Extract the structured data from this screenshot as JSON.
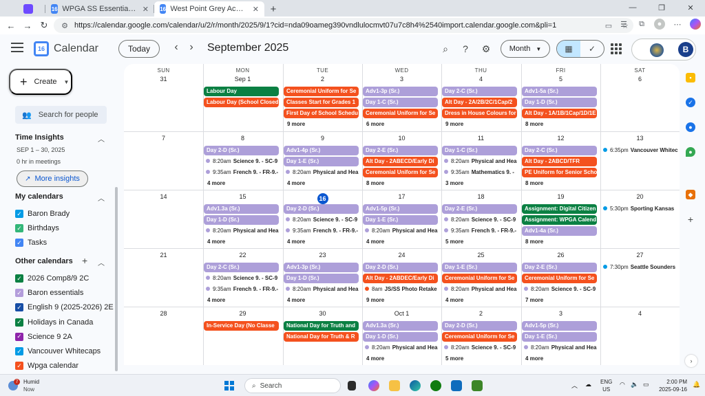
{
  "browser": {
    "tabs": [
      {
        "title": "WPGA SS Essential Calendar",
        "icon": "calendar-tab-icon",
        "color": "#4285f4"
      },
      {
        "title": "West Point Grey Academy - Calen",
        "icon": "calendar-tab-icon",
        "color": "#4285f4"
      }
    ],
    "url": "https://calendar.google.com/calendar/u/2/r/month/2025/9/1?cid=nda09oameg390vndlulocmvt07u7c8h4%2540import.calendar.google.com&pli=1"
  },
  "header": {
    "app_title": "Calendar",
    "logo_text": "16",
    "today_label": "Today",
    "month_title": "September 2025",
    "view_label": "Month",
    "avatar_letter": "B"
  },
  "sidebar": {
    "create_label": "Create",
    "search_people_placeholder": "Search for people",
    "time_insights_title": "Time Insights",
    "insights_range": "SEP 1 – 30, 2025",
    "insights_meetings": "0 hr in meetings",
    "more_insights_label": "More insights",
    "my_calendars_title": "My calendars",
    "my_calendars": [
      {
        "label": "Baron Brady",
        "color": "#039be5"
      },
      {
        "label": "Birthdays",
        "color": "#33b679"
      },
      {
        "label": "Tasks",
        "color": "#4285f4"
      }
    ],
    "other_calendars_title": "Other calendars",
    "other_calendars": [
      {
        "label": "2026 Comp8/9 2C",
        "color": "#0b8043"
      },
      {
        "label": "Baron essentials",
        "color": "#b39ddb"
      },
      {
        "label": "English 9 (2025-2026) 2E",
        "color": "#174ea6"
      },
      {
        "label": "Holidays in Canada",
        "color": "#0b8043"
      },
      {
        "label": "Science 9 2A",
        "color": "#8e24aa"
      },
      {
        "label": "Vancouver Whitecaps",
        "color": "#039be5"
      },
      {
        "label": "Wpga calendar",
        "color": "#f4511e"
      }
    ]
  },
  "calendar": {
    "weekdays": [
      "SUN",
      "MON",
      "TUE",
      "WED",
      "THU",
      "FRI",
      "SAT"
    ],
    "weeks": [
      [
        {
          "label": "31",
          "items": []
        },
        {
          "label": "Sep 1",
          "items": [
            {
              "kind": "chip",
              "color": "green",
              "text": "Labour Day"
            },
            {
              "kind": "chip",
              "color": "red",
              "text": "Labour Day (School Closed)"
            }
          ]
        },
        {
          "label": "2",
          "items": [
            {
              "kind": "chip",
              "color": "red",
              "text": "Ceremonial Uniform for Se"
            },
            {
              "kind": "chip",
              "color": "red",
              "text": "Classes Start for Grades 1"
            },
            {
              "kind": "chip",
              "color": "red",
              "text": "First Day of School Schedu"
            }
          ],
          "more": "9 more"
        },
        {
          "label": "3",
          "items": [
            {
              "kind": "chip",
              "color": "purple",
              "text": "Adv1-3p (Sr.)"
            },
            {
              "kind": "chip",
              "color": "purple",
              "text": "Day 1-C (Sr.)"
            },
            {
              "kind": "chip",
              "color": "red",
              "text": "Ceremonial Uniform for Se"
            }
          ],
          "more": "6 more"
        },
        {
          "label": "4",
          "items": [
            {
              "kind": "chip",
              "color": "purple",
              "text": "Day 2-C (Sr.)"
            },
            {
              "kind": "chip",
              "color": "red",
              "text": "Alt Day - 2A/2B/2C/1Cap/2"
            },
            {
              "kind": "chip",
              "color": "red",
              "text": "Dress in House Colours for"
            }
          ],
          "more": "9 more"
        },
        {
          "label": "5",
          "items": [
            {
              "kind": "chip",
              "color": "purple",
              "text": "Adv1-5a (Sr.)"
            },
            {
              "kind": "chip",
              "color": "purple",
              "text": "Day 1-D (Sr.)"
            },
            {
              "kind": "chip",
              "color": "red",
              "text": "Alt Day - 1A/1B/1Cap/1D/1E"
            }
          ],
          "more": "8 more"
        },
        {
          "label": "6",
          "items": []
        }
      ],
      [
        {
          "label": "7",
          "items": []
        },
        {
          "label": "8",
          "items": [
            {
              "kind": "chip",
              "color": "purple",
              "text": "Day 2-D (Sr.)"
            },
            {
              "kind": "event",
              "dot": "#ad9fd9",
              "time": "8:20am",
              "title": "Science 9. - SC-9"
            },
            {
              "kind": "event",
              "dot": "#ad9fd9",
              "time": "9:35am",
              "title": "French 9. - FR-9.-"
            }
          ],
          "more": "4 more"
        },
        {
          "label": "9",
          "items": [
            {
              "kind": "chip",
              "color": "purple",
              "text": "Adv1-4p (Sr.)"
            },
            {
              "kind": "chip",
              "color": "purple",
              "text": "Day 1-E (Sr.)"
            },
            {
              "kind": "event",
              "dot": "#ad9fd9",
              "time": "8:20am",
              "title": "Physical and Hea"
            }
          ],
          "more": "4 more"
        },
        {
          "label": "10",
          "items": [
            {
              "kind": "chip",
              "color": "purple",
              "text": "Day 2-E (Sr.)"
            },
            {
              "kind": "chip",
              "color": "red",
              "text": "Alt Day - 2ABECD/Early Di"
            },
            {
              "kind": "chip",
              "color": "red",
              "text": "Ceremonial Uniform for Se"
            }
          ],
          "more": "8 more"
        },
        {
          "label": "11",
          "items": [
            {
              "kind": "chip",
              "color": "purple",
              "text": "Day 1-C (Sr.)"
            },
            {
              "kind": "event",
              "dot": "#ad9fd9",
              "time": "8:20am",
              "title": "Physical and Hea"
            },
            {
              "kind": "event",
              "dot": "#ad9fd9",
              "time": "9:35am",
              "title": "Mathematics 9. -"
            }
          ],
          "more": "3 more"
        },
        {
          "label": "12",
          "items": [
            {
              "kind": "chip",
              "color": "purple",
              "text": "Day 2-C (Sr.)"
            },
            {
              "kind": "chip",
              "color": "red",
              "text": "Alt Day - 2ABCD/TFR"
            },
            {
              "kind": "chip",
              "color": "red",
              "text": "PE Uniform for Senior Scho"
            }
          ],
          "more": "8 more"
        },
        {
          "label": "13",
          "items": [
            {
              "kind": "event",
              "dot": "#039be5",
              "time": "6:35pm",
              "title": "Vancouver Whitec",
              "plain": true
            }
          ]
        }
      ],
      [
        {
          "label": "14",
          "items": []
        },
        {
          "label": "15",
          "items": [
            {
              "kind": "chip",
              "color": "purple",
              "text": "Adv1.3a (Sr.)"
            },
            {
              "kind": "chip",
              "color": "purple",
              "text": "Day 1-D (Sr.)"
            },
            {
              "kind": "event",
              "dot": "#ad9fd9",
              "time": "8:20am",
              "title": "Physical and Hea"
            }
          ],
          "more": "4 more"
        },
        {
          "label": "16",
          "today": true,
          "items": [
            {
              "kind": "chip",
              "color": "purple",
              "text": "Day 2-D (Sr.)"
            },
            {
              "kind": "event",
              "dot": "#ad9fd9",
              "time": "8:20am",
              "title": "Science 9. - SC-9"
            },
            {
              "kind": "event",
              "dot": "#ad9fd9",
              "time": "9:35am",
              "title": "French 9. - FR-9.-"
            }
          ],
          "more": "4 more"
        },
        {
          "label": "17",
          "items": [
            {
              "kind": "chip",
              "color": "purple",
              "text": "Adv1-5p (Sr.)"
            },
            {
              "kind": "chip",
              "color": "purple",
              "text": "Day 1-E (Sr.)"
            },
            {
              "kind": "event",
              "dot": "#ad9fd9",
              "time": "8:20am",
              "title": "Physical and Hea"
            }
          ],
          "more": "4 more"
        },
        {
          "label": "18",
          "items": [
            {
              "kind": "chip",
              "color": "purple",
              "text": "Day 2-E (Sr.)"
            },
            {
              "kind": "event",
              "dot": "#ad9fd9",
              "time": "8:20am",
              "title": "Science 9. - SC-9"
            },
            {
              "kind": "event",
              "dot": "#ad9fd9",
              "time": "9:35am",
              "title": "French 9. - FR-9.-"
            }
          ],
          "more": "5 more"
        },
        {
          "label": "19",
          "items": [
            {
              "kind": "chip",
              "color": "green",
              "text": "Assignment: Digital Citizen"
            },
            {
              "kind": "chip",
              "color": "green",
              "text": "Assignment: WPGA Calend"
            },
            {
              "kind": "chip",
              "color": "purple",
              "text": "Adv1-4a (Sr.)"
            }
          ],
          "more": "8 more"
        },
        {
          "label": "20",
          "items": [
            {
              "kind": "event",
              "dot": "#039be5",
              "time": "5:30pm",
              "title": "Sporting Kansas",
              "plain": true
            }
          ]
        }
      ],
      [
        {
          "label": "21",
          "items": []
        },
        {
          "label": "22",
          "items": [
            {
              "kind": "chip",
              "color": "purple",
              "text": "Day 2-C (Sr.)"
            },
            {
              "kind": "event",
              "dot": "#ad9fd9",
              "time": "8:20am",
              "title": "Science 9. - SC-9"
            },
            {
              "kind": "event",
              "dot": "#ad9fd9",
              "time": "9:35am",
              "title": "French 9. - FR-9.-"
            }
          ],
          "more": "4 more"
        },
        {
          "label": "23",
          "items": [
            {
              "kind": "chip",
              "color": "purple",
              "text": "Adv1-3p (Sr.)"
            },
            {
              "kind": "chip",
              "color": "purple",
              "text": "Day 1-D (Sr.)"
            },
            {
              "kind": "event",
              "dot": "#ad9fd9",
              "time": "8:20am",
              "title": "Physical and Hea"
            }
          ],
          "more": "4 more"
        },
        {
          "label": "24",
          "items": [
            {
              "kind": "chip",
              "color": "purple",
              "text": "Day 2-D (Sr.)"
            },
            {
              "kind": "chip",
              "color": "red",
              "text": "Alt Day - 2ABDEC/Early Di"
            },
            {
              "kind": "event",
              "dot": "#f4511e",
              "time": "8am",
              "title": "JS/SS Photo Retake"
            }
          ],
          "more": "9 more"
        },
        {
          "label": "25",
          "items": [
            {
              "kind": "chip",
              "color": "purple",
              "text": "Day 1-E (Sr.)"
            },
            {
              "kind": "chip",
              "color": "red",
              "text": "Ceremonial Uniform for Se"
            },
            {
              "kind": "event",
              "dot": "#ad9fd9",
              "time": "8:20am",
              "title": "Physical and Hea"
            }
          ],
          "more": "4 more"
        },
        {
          "label": "26",
          "items": [
            {
              "kind": "chip",
              "color": "purple",
              "text": "Day 2-E (Sr.)"
            },
            {
              "kind": "chip",
              "color": "red",
              "text": "Ceremonial Uniform for Se"
            },
            {
              "kind": "event",
              "dot": "#ad9fd9",
              "time": "8:20am",
              "title": "Science 9. - SC-9"
            }
          ],
          "more": "7 more"
        },
        {
          "label": "27",
          "items": [
            {
              "kind": "event",
              "dot": "#039be5",
              "time": "7:30pm",
              "title": "Seattle Sounders",
              "plain": true
            }
          ]
        }
      ],
      [
        {
          "label": "28",
          "items": []
        },
        {
          "label": "29",
          "items": [
            {
              "kind": "chip",
              "color": "red",
              "text": "In-Service Day (No Classe"
            }
          ]
        },
        {
          "label": "30",
          "items": [
            {
              "kind": "chip",
              "color": "green",
              "text": "National Day for Truth and"
            },
            {
              "kind": "chip",
              "color": "red",
              "text": "National Day for Truth & R"
            }
          ]
        },
        {
          "label": "Oct 1",
          "items": [
            {
              "kind": "chip",
              "color": "purple",
              "text": "Adv1.3a (Sr.)"
            },
            {
              "kind": "chip",
              "color": "purple",
              "text": "Day 1-D (Sr.)"
            },
            {
              "kind": "event",
              "dot": "#ad9fd9",
              "time": "8:20am",
              "title": "Physical and Hea"
            }
          ],
          "more": "4 more"
        },
        {
          "label": "2",
          "items": [
            {
              "kind": "chip",
              "color": "purple",
              "text": "Day 2-D (Sr.)"
            },
            {
              "kind": "chip",
              "color": "red",
              "text": "Ceremonial Uniform for Se"
            },
            {
              "kind": "event",
              "dot": "#ad9fd9",
              "time": "8:20am",
              "title": "Science 9. - SC-9"
            }
          ],
          "more": "5 more"
        },
        {
          "label": "3",
          "items": [
            {
              "kind": "chip",
              "color": "purple",
              "text": "Adv1-5p (Sr.)"
            },
            {
              "kind": "chip",
              "color": "purple",
              "text": "Day 1-E (Sr.)"
            },
            {
              "kind": "event",
              "dot": "#ad9fd9",
              "time": "8:20am",
              "title": "Physical and Hea"
            }
          ],
          "more": "4 more"
        },
        {
          "label": "4",
          "items": []
        }
      ]
    ]
  },
  "taskbar": {
    "weather_label": "Humid",
    "weather_sub": "Now",
    "weather_badge": "7",
    "search_placeholder": "Search",
    "lang_line1": "ENG",
    "lang_line2": "US",
    "time": "2:00 PM",
    "date": "2025-09-16"
  },
  "colors": {
    "purple_chip": "#ad9fd9",
    "red_chip": "#f4511e",
    "green_chip": "#0b8043",
    "today_blue": "#0b57d0"
  }
}
